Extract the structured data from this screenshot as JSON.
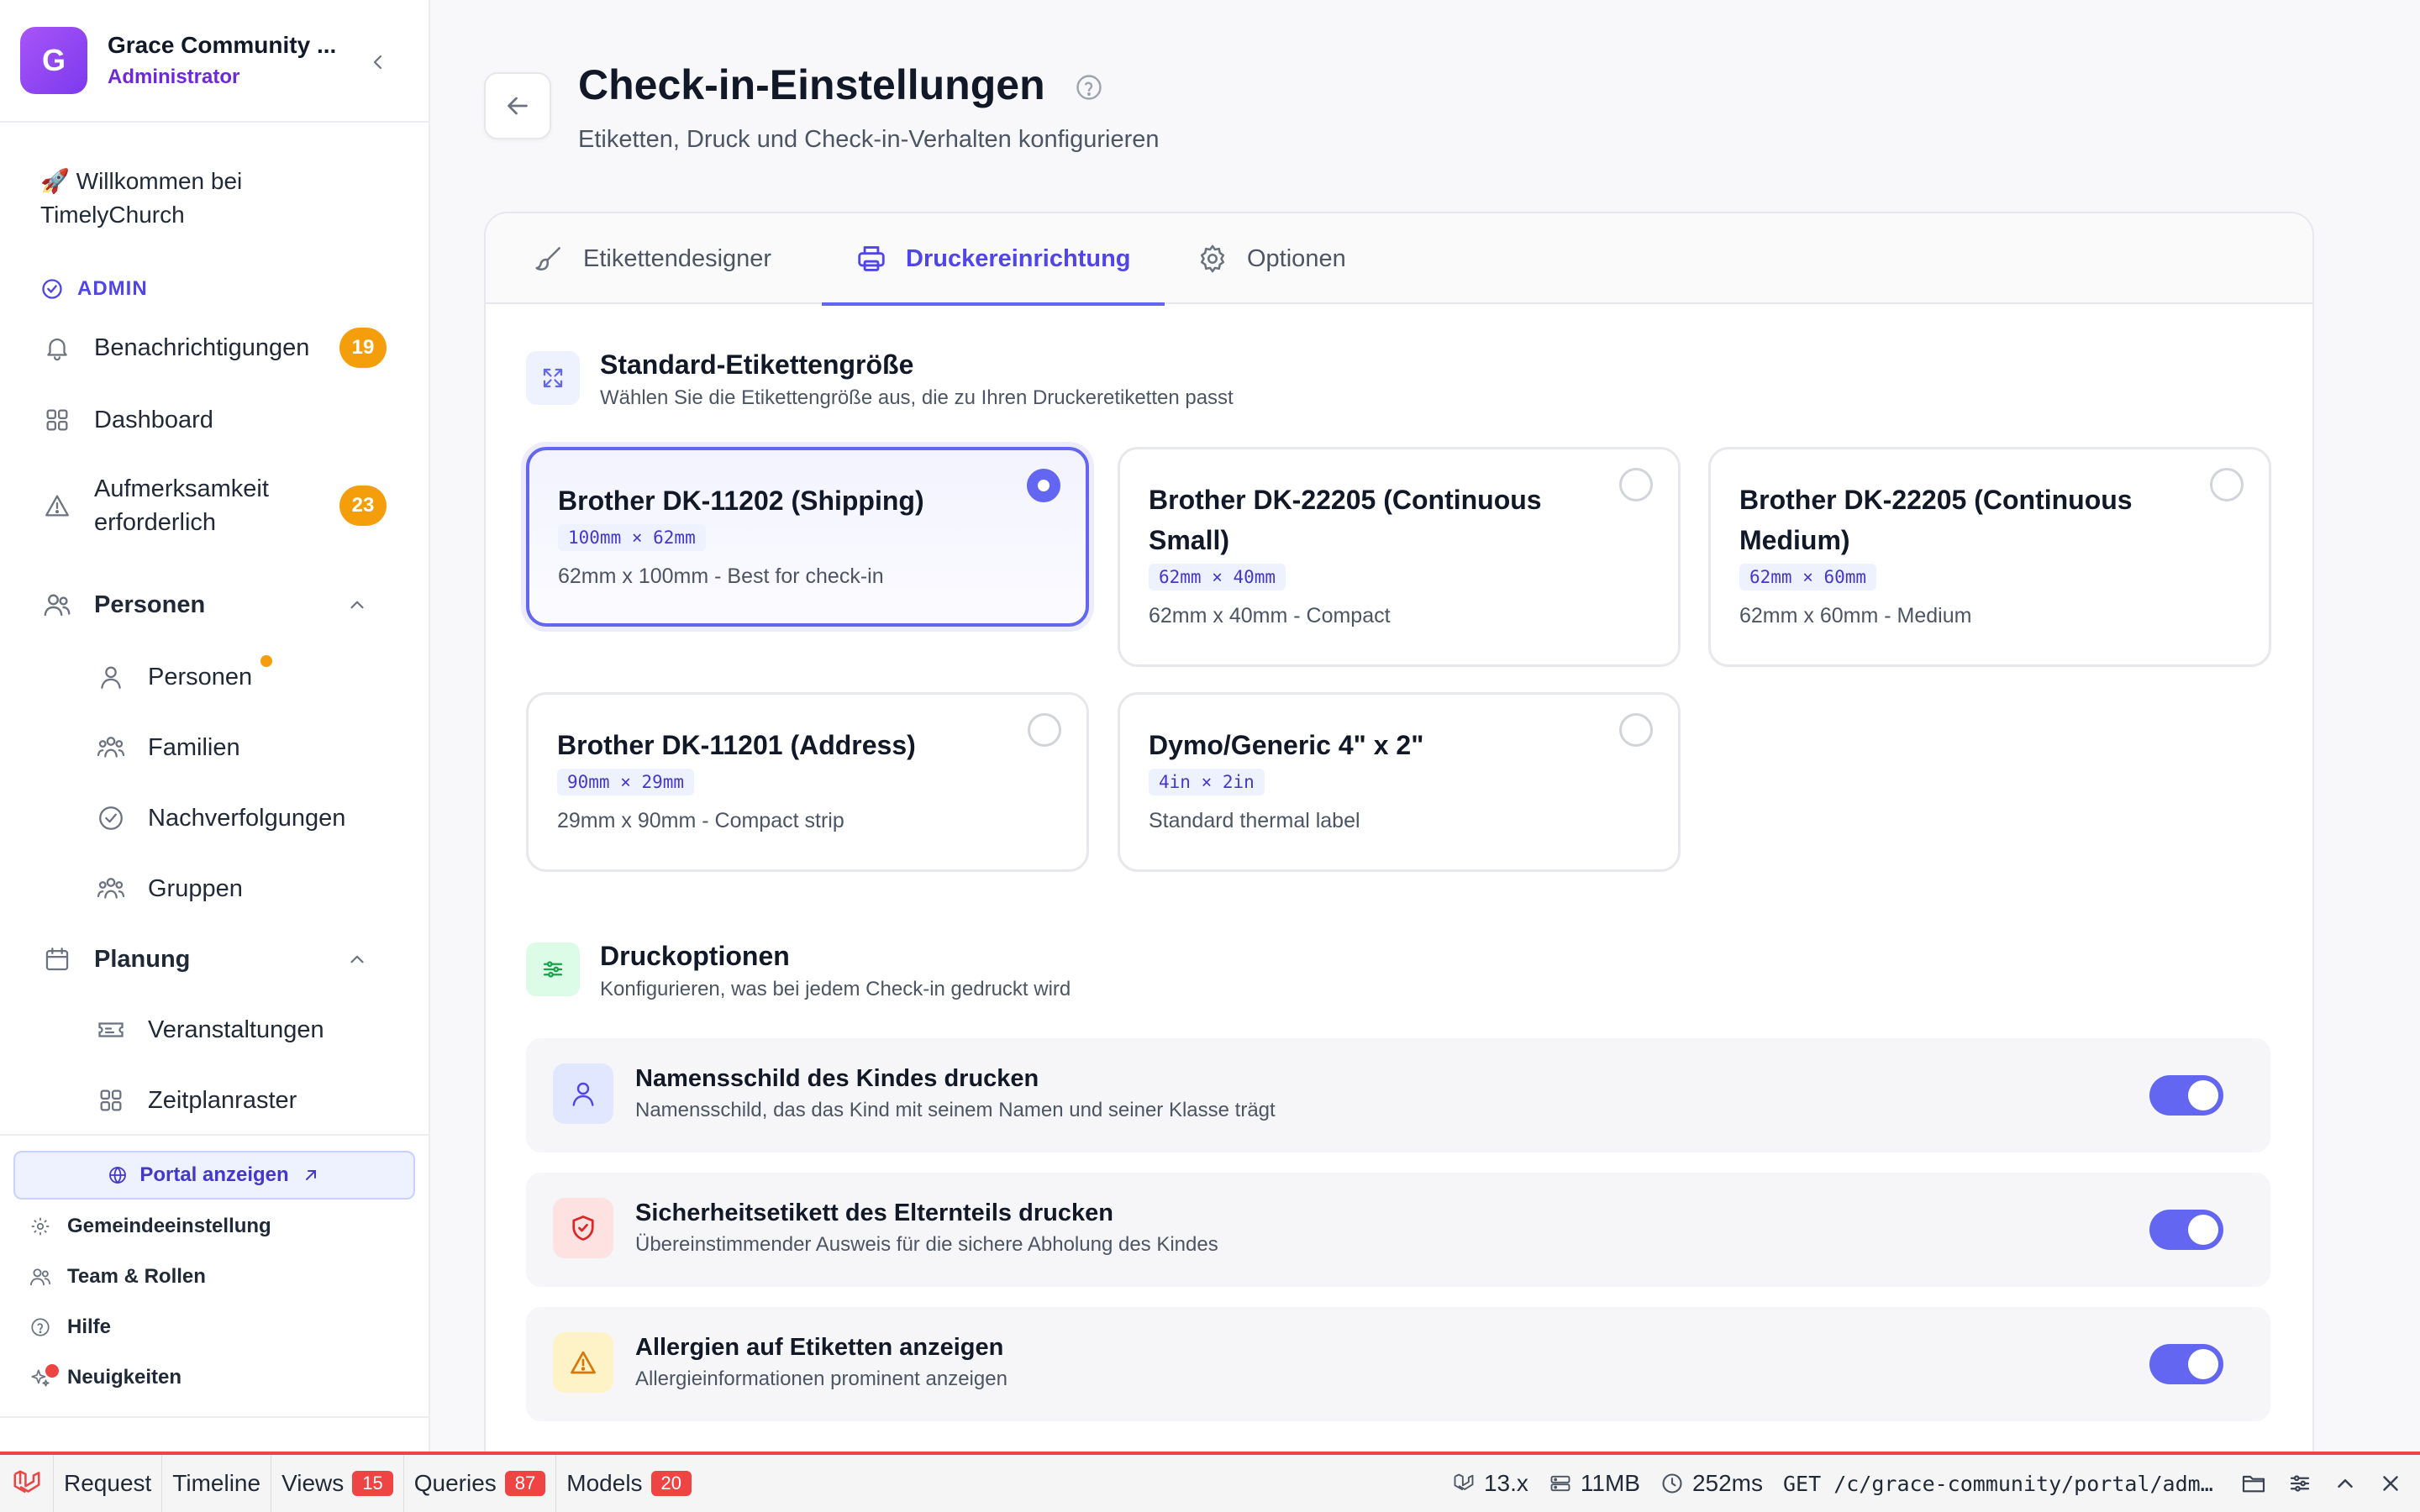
{
  "org": {
    "initial": "G",
    "name": "Grace Community ...",
    "role": "Administrator"
  },
  "sidebar": {
    "welcome": "🚀 Willkommen bei TimelyChurch",
    "admin_label": "ADMIN",
    "items": [
      {
        "label": "Benachrichtigungen",
        "badge": "19"
      },
      {
        "label": "Dashboard"
      },
      {
        "label": "Aufmerksamkeit erforderlich",
        "badge": "23"
      }
    ],
    "groups": [
      {
        "label": "Personen",
        "children": [
          "Personen",
          "Familien",
          "Nachverfolgungen",
          "Gruppen"
        ]
      },
      {
        "label": "Planung",
        "children": [
          "Veranstaltungen",
          "Zeitplanraster"
        ]
      }
    ],
    "portal_button": "Portal anzeigen",
    "footer": [
      "Gemeindeeinstellung",
      "Team & Rollen",
      "Hilfe",
      "Neuigkeiten"
    ]
  },
  "header": {
    "title": "Check-in-Einstellungen",
    "subtitle": "Etiketten, Druck und Check-in-Verhalten konfigurieren"
  },
  "tabs": [
    {
      "label": "Etikettendesigner",
      "icon": "brush-icon"
    },
    {
      "label": "Druckereinrichtung",
      "icon": "printer-icon",
      "active": true
    },
    {
      "label": "Optionen",
      "icon": "gear-icon"
    }
  ],
  "label_size": {
    "title": "Standard-Etikettengröße",
    "subtitle": "Wählen Sie die Etikettengröße aus, die zu Ihren Druckeretiketten passt",
    "options": [
      {
        "name": "Brother DK-11202 (Shipping)",
        "dims": "100mm × 62mm",
        "desc": "62mm x 100mm - Best for check-in",
        "selected": true
      },
      {
        "name": "Brother DK-22205 (Continuous Small)",
        "dims": "62mm × 40mm",
        "desc": "62mm x 40mm - Compact",
        "selected": false
      },
      {
        "name": "Brother DK-22205 (Continuous Medium)",
        "dims": "62mm × 60mm",
        "desc": "62mm x 60mm - Medium",
        "selected": false
      },
      {
        "name": "Brother DK-11201 (Address)",
        "dims": "90mm × 29mm",
        "desc": "29mm x 90mm - Compact strip",
        "selected": false
      },
      {
        "name": "Dymo/Generic 4\" x 2\"",
        "dims": "4in × 2in",
        "desc": "Standard thermal label",
        "selected": false
      }
    ]
  },
  "print_options": {
    "title": "Druckoptionen",
    "subtitle": "Konfigurieren, was bei jedem Check-in gedruckt wird",
    "items": [
      {
        "title": "Namensschild des Kindes drucken",
        "desc": "Namensschild, das das Kind mit seinem Namen und seiner Klasse trägt",
        "enabled": true
      },
      {
        "title": "Sicherheitsetikett des Elternteils drucken",
        "desc": "Übereinstimmender Ausweis für die sichere Abholung des Kindes",
        "enabled": true
      },
      {
        "title": "Allergien auf Etiketten anzeigen",
        "desc": "Allergieinformationen prominent anzeigen",
        "enabled": true
      }
    ]
  },
  "debugbar": {
    "tabs": [
      {
        "label": "Request"
      },
      {
        "label": "Timeline"
      },
      {
        "label": "Views",
        "badge": "15"
      },
      {
        "label": "Queries",
        "badge": "87"
      },
      {
        "label": "Models",
        "badge": "20"
      }
    ],
    "version": "13.x",
    "memory": "11MB",
    "time": "252ms",
    "route": "GET /c/grace-community/portal/adm..."
  },
  "colors": {
    "accent": "#6366f1",
    "badge": "#f59e0b",
    "debug_red": "#ef4444"
  }
}
